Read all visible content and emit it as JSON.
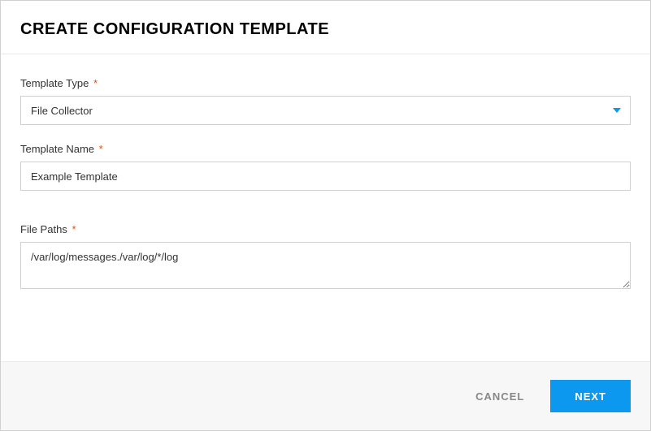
{
  "dialog": {
    "title": "CREATE CONFIGURATION TEMPLATE"
  },
  "form": {
    "templateType": {
      "label": "Template Type",
      "required": "*",
      "value": "File Collector"
    },
    "templateName": {
      "label": "Template Name",
      "required": "*",
      "value": "Example Template"
    },
    "filePaths": {
      "label": "File Paths",
      "required": "*",
      "value": "/var/log/messages./var/log/*/log"
    }
  },
  "footer": {
    "cancel": "CANCEL",
    "next": "NEXT"
  }
}
